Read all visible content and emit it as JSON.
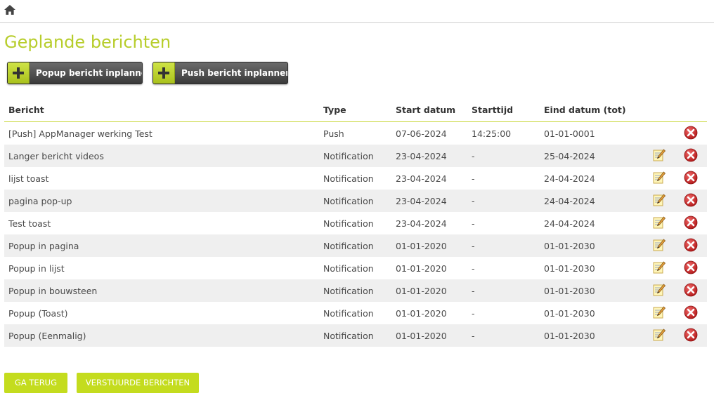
{
  "page": {
    "title": "Geplande berichten"
  },
  "actions": {
    "popup_label": "Popup bericht inplannen",
    "push_label": "Push bericht inplannen"
  },
  "table": {
    "headers": [
      "Bericht",
      "Type",
      "Start datum",
      "Starttijd",
      "Eind datum (tot)"
    ],
    "rows": [
      {
        "bericht": "[Push] AppManager werking Test",
        "type": "Push",
        "start_datum": "07-06-2024",
        "starttijd": "14:25:00",
        "eind_datum": "01-01-0001",
        "editable": false
      },
      {
        "bericht": "Langer bericht videos",
        "type": "Notification",
        "start_datum": "23-04-2024",
        "starttijd": "-",
        "eind_datum": "25-04-2024",
        "editable": true
      },
      {
        "bericht": "lijst toast",
        "type": "Notification",
        "start_datum": "23-04-2024",
        "starttijd": "-",
        "eind_datum": "24-04-2024",
        "editable": true
      },
      {
        "bericht": "pagina pop-up",
        "type": "Notification",
        "start_datum": "23-04-2024",
        "starttijd": "-",
        "eind_datum": "24-04-2024",
        "editable": true
      },
      {
        "bericht": "Test toast",
        "type": "Notification",
        "start_datum": "23-04-2024",
        "starttijd": "-",
        "eind_datum": "24-04-2024",
        "editable": true
      },
      {
        "bericht": "Popup in pagina",
        "type": "Notification",
        "start_datum": "01-01-2020",
        "starttijd": "-",
        "eind_datum": "01-01-2030",
        "editable": true
      },
      {
        "bericht": "Popup in lijst",
        "type": "Notification",
        "start_datum": "01-01-2020",
        "starttijd": "-",
        "eind_datum": "01-01-2030",
        "editable": true
      },
      {
        "bericht": "Popup in bouwsteen",
        "type": "Notification",
        "start_datum": "01-01-2020",
        "starttijd": "-",
        "eind_datum": "01-01-2030",
        "editable": true
      },
      {
        "bericht": "Popup (Toast)",
        "type": "Notification",
        "start_datum": "01-01-2020",
        "starttijd": "-",
        "eind_datum": "01-01-2030",
        "editable": true
      },
      {
        "bericht": "Popup (Eenmalig)",
        "type": "Notification",
        "start_datum": "01-01-2020",
        "starttijd": "-",
        "eind_datum": "01-01-2030",
        "editable": true
      }
    ]
  },
  "footer": {
    "back_label": "GA TERUG",
    "sent_label": "VERSTUURDE BERICHTEN"
  },
  "icons": {
    "home": "home-icon",
    "add": "plus-icon",
    "edit": "edit-note-icon",
    "delete": "delete-x-icon"
  },
  "colors": {
    "accent": "#b7cd2b",
    "button_green": "#c4dc1e",
    "action_dark": "#4a4a4a",
    "delete_red": "#d22a2a",
    "row_alt": "#efefef"
  }
}
